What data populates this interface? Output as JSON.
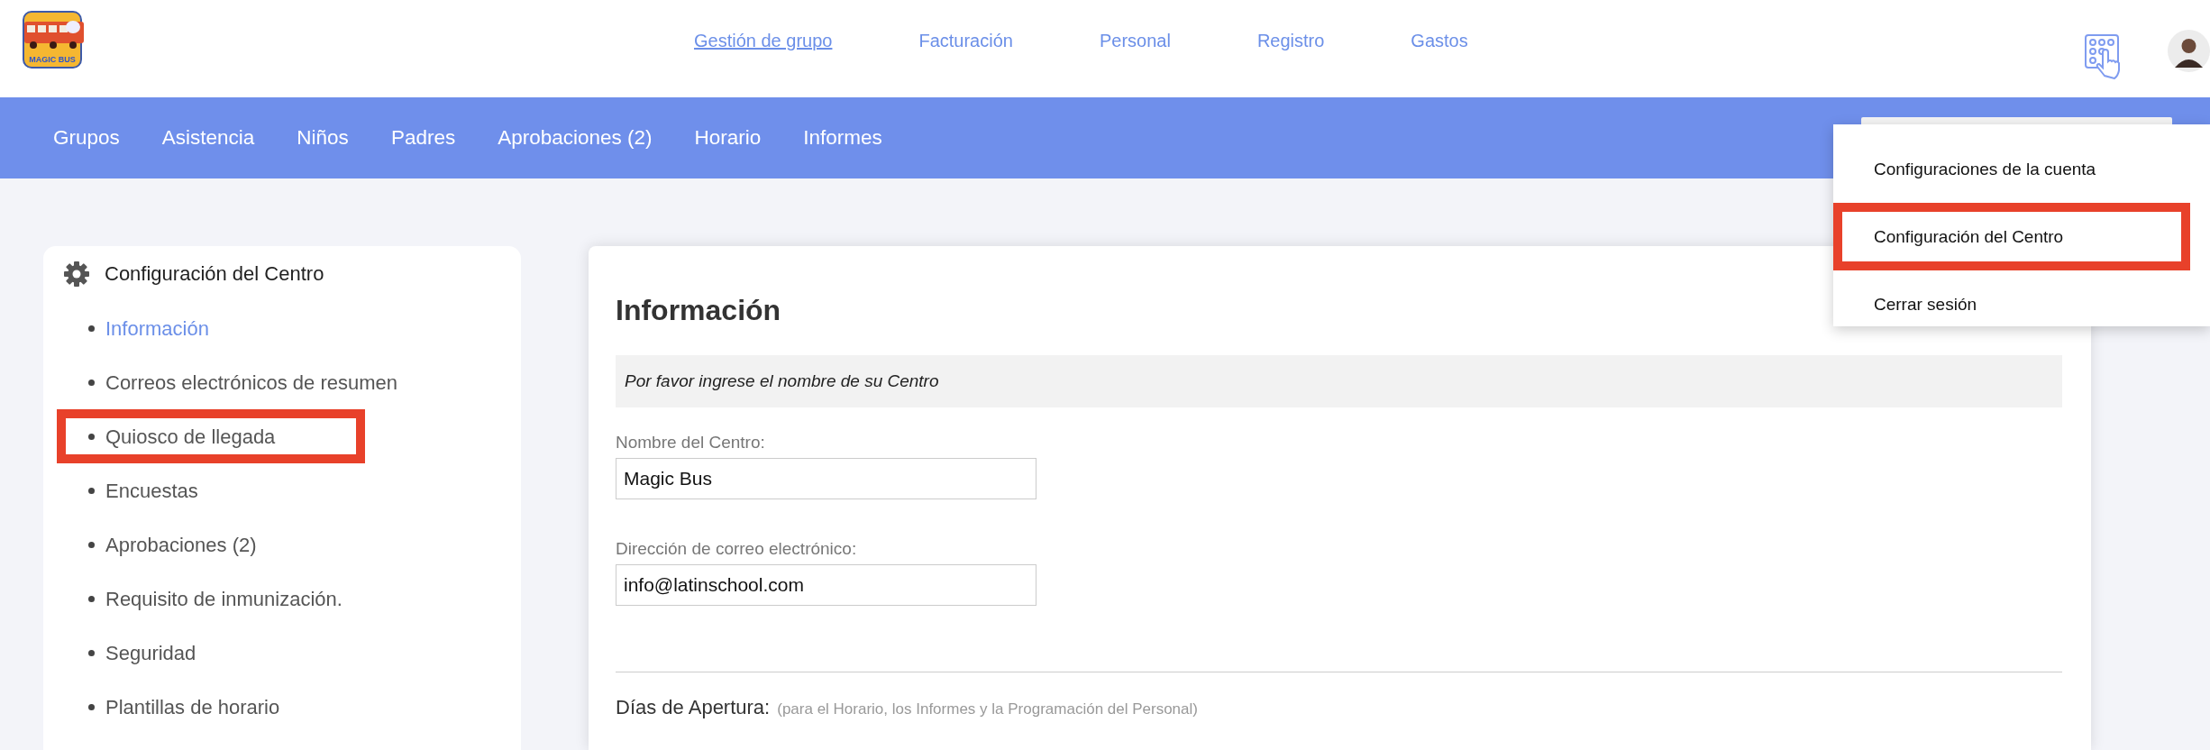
{
  "logo": {
    "text": "MAGIC BUS"
  },
  "top_nav": [
    {
      "label": "Gestión de grupo",
      "selected": true
    },
    {
      "label": "Facturación",
      "selected": false
    },
    {
      "label": "Personal",
      "selected": false
    },
    {
      "label": "Registro",
      "selected": false
    },
    {
      "label": "Gastos",
      "selected": false
    }
  ],
  "main_nav": [
    {
      "label": "Grupos"
    },
    {
      "label": "Asistencia"
    },
    {
      "label": "Niños"
    },
    {
      "label": "Padres"
    },
    {
      "label": "Aprobaciones (2)"
    },
    {
      "label": "Horario"
    },
    {
      "label": "Informes"
    }
  ],
  "user_menu": {
    "items": [
      {
        "label": "Configuraciones de la cuenta",
        "highlighted": false
      },
      {
        "label": "Configuración del Centro",
        "highlighted": true
      },
      {
        "label": "Cerrar sesión",
        "highlighted": false
      }
    ]
  },
  "sidebar": {
    "title": "Configuración del Centro",
    "items": [
      {
        "label": "Información",
        "selected": true,
        "highlighted": false
      },
      {
        "label": "Correos electrónicos de resumen",
        "selected": false,
        "highlighted": false
      },
      {
        "label": "Quiosco de llegada",
        "selected": false,
        "highlighted": true
      },
      {
        "label": "Encuestas",
        "selected": false,
        "highlighted": false
      },
      {
        "label": "Aprobaciones (2)",
        "selected": false,
        "highlighted": false
      },
      {
        "label": "Requisito de inmunización.",
        "selected": false,
        "highlighted": false
      },
      {
        "label": "Seguridad",
        "selected": false,
        "highlighted": false
      },
      {
        "label": "Plantillas de horario",
        "selected": false,
        "highlighted": false
      }
    ]
  },
  "panel": {
    "title": "Información",
    "notice": "Por favor ingrese el nombre de su Centro",
    "fields": [
      {
        "label": "Nombre del Centro:",
        "value": "Magic Bus"
      },
      {
        "label": "Dirección de correo electrónico:",
        "value": "info@latinschool.com"
      }
    ],
    "section": {
      "title": "Días de Apertura:",
      "note": "(para el Horario, los Informes y la Programación del Personal)"
    }
  }
}
